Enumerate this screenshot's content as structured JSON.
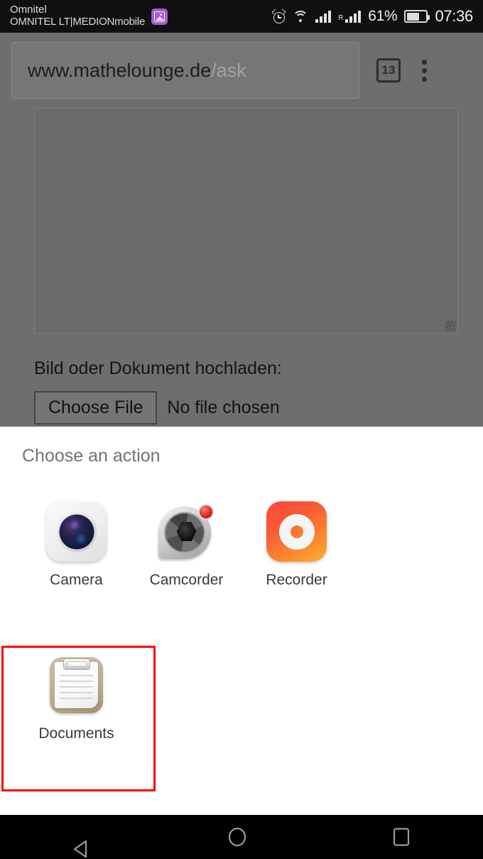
{
  "status_bar": {
    "carrier_line1": "Omnitel",
    "carrier_line2": "OMNITEL LT|MEDIONmobile",
    "notification_icon": "image-photo-icon",
    "alarm_icon": "alarm-clock-icon",
    "wifi_icon": "wifi-icon",
    "sim1_icon": "signal-bars-icon",
    "roaming_label": "R",
    "sim2_icon": "signal-bars-icon",
    "battery_percent": "61%",
    "battery_icon": "battery-icon",
    "clock": "07:36"
  },
  "browser": {
    "url_host": "www.mathelounge.de",
    "url_path": "/ask",
    "tab_count": "13",
    "menu_icon": "kebab-menu-icon",
    "tab_icon": "tab-counter-icon"
  },
  "page": {
    "textarea_value": "",
    "upload_label": "Bild oder Dokument hochladen:",
    "choose_file_button": "Choose File",
    "file_status": "No file chosen",
    "resize_handle": "resize-grip-icon"
  },
  "sheet": {
    "title": "Choose an action",
    "actions": [
      {
        "label": "Camera",
        "icon": "camera-icon",
        "selected": false
      },
      {
        "label": "Camcorder",
        "icon": "camcorder-icon",
        "selected": false
      },
      {
        "label": "Recorder",
        "icon": "recorder-icon",
        "selected": false
      },
      {
        "label": "Documents",
        "icon": "documents-clipboard-icon",
        "selected": true
      }
    ]
  },
  "annotation": {
    "color": "#fe0000",
    "target": "Documents"
  },
  "navbar": {
    "back": "back-triangle-icon",
    "home": "home-circle-icon",
    "recents": "recents-square-icon"
  },
  "colors": {
    "status_bar_bg": "#100f12",
    "dimmed_chrome": "#6e6e6e",
    "sheet_bg": "#ffffff",
    "accent_red": "#fe0000",
    "notification_purple": "#a45ecb"
  }
}
